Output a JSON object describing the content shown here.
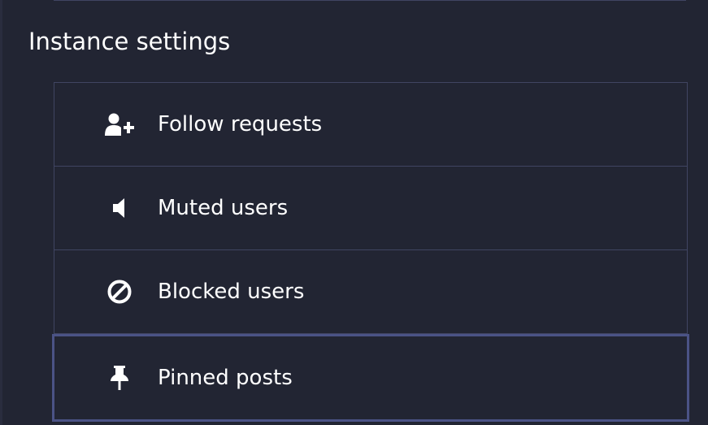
{
  "section": {
    "title": "Instance settings"
  },
  "menu": {
    "items": [
      {
        "label": "Follow requests",
        "icon": "user-plus-icon"
      },
      {
        "label": "Muted users",
        "icon": "volume-mute-icon"
      },
      {
        "label": "Blocked users",
        "icon": "block-icon"
      },
      {
        "label": "Pinned posts",
        "icon": "pin-icon"
      }
    ]
  },
  "colors": {
    "background": "#222533",
    "border": "#404562",
    "focus_border": "#4b5386",
    "text": "#ffffff"
  }
}
